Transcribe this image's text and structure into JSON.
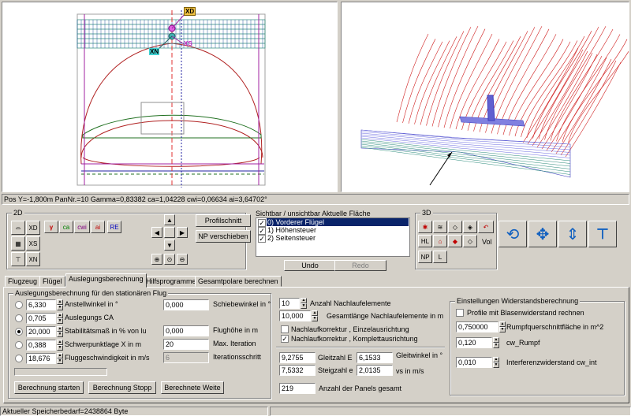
{
  "status_top": "Pos Y=-1,800m PanNr.=10 Gamma=0,83382 ca=1,04228 cwi=0,06634 ai=3,64702°",
  "view2d": {
    "label_xd": "XD",
    "label_xs": "XS",
    "label_xn": "XN"
  },
  "panel2d": {
    "title": "2D",
    "btn_xd": "XD",
    "btn_xs": "XS",
    "btn_xn": "XN",
    "btn_gamma": "γ",
    "btn_ca": "ca",
    "btn_cwi": "cwi",
    "btn_ai": "ai",
    "btn_re": "RE",
    "btn_profilschnitt": "Profilschnitt",
    "btn_np": "NP verschieben"
  },
  "visibility": {
    "header": "Sichtbar / unsichtbar    Aktuelle Fläche",
    "items": [
      "0) Vorderer Flügel",
      "1) Höhensteuer",
      "2) Seitensteuer"
    ],
    "undo": "Undo",
    "redo": "Redo"
  },
  "panel3d": {
    "title": "3D",
    "hl": "HL",
    "np": "NP",
    "l": "L",
    "vol": "Vol"
  },
  "tabs": [
    "Flugzeug",
    "Flügel",
    "Auslegungsberechnung",
    "Hilfsprogramme",
    "Gesamtpolare berechnen"
  ],
  "active_tab": "Auslegungsberechnung",
  "group_flight": {
    "title": "Auslegungsberechnung für den stationären Flug",
    "rows": [
      {
        "value": "6,330",
        "label": "Anstellwinkel in °",
        "selected": false
      },
      {
        "value": "0,705",
        "label": "Auslegungs CA",
        "selected": false
      },
      {
        "value": "20,000",
        "label": "Stabilitätsmaß in % von lu",
        "selected": true
      },
      {
        "value": "0,388",
        "label": "Schwerpunktlage X in m",
        "selected": false
      },
      {
        "value": "18,676",
        "label": "Fluggeschwindigkeit in m/s",
        "selected": false
      }
    ],
    "right_rows": [
      {
        "value": "0,000",
        "label": "Schiebewinkel in °"
      },
      {
        "value": "0,000",
        "label": "Flughöhe in m"
      },
      {
        "value": "20",
        "label": "Max. Iteration"
      },
      {
        "value": "6",
        "label": "Iterationsschritt"
      }
    ],
    "btn_start": "Berechnung starten",
    "btn_stop": "Berechnung Stopp",
    "btn_weights": "Berechnete Weite"
  },
  "group_wake": {
    "count_value": "10",
    "count_label": "Anzahl Nachlaufelemente",
    "length_value": "10,000",
    "length_label": "Gesamtlänge Nachlaufelemente in m",
    "chk1": "Nachlaufkorrektur , Einzelausrichtung",
    "chk1_on": false,
    "chk2": "Nachlaufkorrektur , Komplettausrichtung",
    "chk2_on": true
  },
  "results": {
    "gleitzahl_value": "9,2755",
    "gleitzahl_label": "Gleitzahl E",
    "gleitwinkel_value": "6,1533",
    "gleitwinkel_label": "Gleitwinkel in °",
    "steigzahl_value": "7,5332",
    "steigzahl_label": "Steigzahl e",
    "vs_value": "2,0135",
    "vs_label": "vs in m/s",
    "panels_value": "219",
    "panels_label": "Anzahl der Panels gesamt"
  },
  "group_drag": {
    "title": "Einstellungen Widerstandsberechnung",
    "chk": "Profile mit Blasenwiderstand rechnen",
    "rumpf_value": "0,750000",
    "rumpf_label": "Rumpfquerschnittfläche in m^2",
    "cw_value": "0,120",
    "cw_label": "cw_Rumpf",
    "int_value": "0,010",
    "int_label": "Interferenzwiderstand cw_int"
  },
  "status_bottom": "Aktueller Speicherbedarf=2438864 Byte"
}
